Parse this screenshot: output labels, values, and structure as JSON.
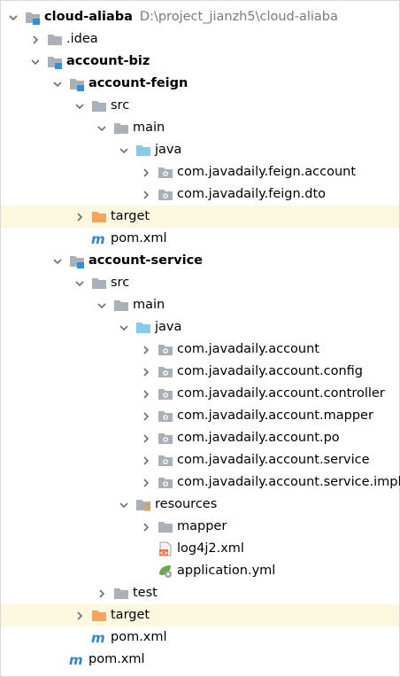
{
  "tree": {
    "nodes": [
      {
        "label": "cloud-aliaba",
        "detail": "D:\\project_jianzh5\\cloud-aliaba",
        "depth": 0,
        "icon": "module-folder-icon",
        "toggle": "expanded",
        "bold": true
      },
      {
        "label": ".idea",
        "depth": 1,
        "icon": "folder-icon",
        "toggle": "collapsed"
      },
      {
        "label": "account-biz",
        "depth": 1,
        "icon": "module-folder-icon",
        "toggle": "expanded",
        "bold": true
      },
      {
        "label": "account-feign",
        "depth": 2,
        "icon": "module-folder-icon",
        "toggle": "expanded",
        "bold": true
      },
      {
        "label": "src",
        "depth": 3,
        "icon": "folder-icon",
        "toggle": "expanded"
      },
      {
        "label": "main",
        "depth": 4,
        "icon": "folder-icon",
        "toggle": "expanded"
      },
      {
        "label": "java",
        "depth": 5,
        "icon": "source-root-folder-icon",
        "toggle": "expanded"
      },
      {
        "label": "com.javadaily.feign.account",
        "depth": 6,
        "icon": "package-icon",
        "toggle": "collapsed"
      },
      {
        "label": "com.javadaily.feign.dto",
        "depth": 6,
        "icon": "package-icon",
        "toggle": "collapsed"
      },
      {
        "label": "target",
        "depth": 3,
        "icon": "excluded-folder-icon",
        "toggle": "collapsed",
        "excluded": true
      },
      {
        "label": "pom.xml",
        "depth": 3,
        "icon": "maven-icon",
        "toggle": "none"
      },
      {
        "label": "account-service",
        "depth": 2,
        "icon": "module-folder-icon",
        "toggle": "expanded",
        "bold": true
      },
      {
        "label": "src",
        "depth": 3,
        "icon": "folder-icon",
        "toggle": "expanded"
      },
      {
        "label": "main",
        "depth": 4,
        "icon": "folder-icon",
        "toggle": "expanded"
      },
      {
        "label": "java",
        "depth": 5,
        "icon": "source-root-folder-icon",
        "toggle": "expanded"
      },
      {
        "label": "com.javadaily.account",
        "depth": 6,
        "icon": "package-icon",
        "toggle": "collapsed"
      },
      {
        "label": "com.javadaily.account.config",
        "depth": 6,
        "icon": "package-icon",
        "toggle": "collapsed"
      },
      {
        "label": "com.javadaily.account.controller",
        "depth": 6,
        "icon": "package-icon",
        "toggle": "collapsed"
      },
      {
        "label": "com.javadaily.account.mapper",
        "depth": 6,
        "icon": "package-icon",
        "toggle": "collapsed"
      },
      {
        "label": "com.javadaily.account.po",
        "depth": 6,
        "icon": "package-icon",
        "toggle": "collapsed"
      },
      {
        "label": "com.javadaily.account.service",
        "depth": 6,
        "icon": "package-icon",
        "toggle": "collapsed"
      },
      {
        "label": "com.javadaily.account.service.impl",
        "depth": 6,
        "icon": "package-icon",
        "toggle": "collapsed"
      },
      {
        "label": "resources",
        "depth": 5,
        "icon": "resources-folder-icon",
        "toggle": "expanded"
      },
      {
        "label": "mapper",
        "depth": 6,
        "icon": "folder-icon",
        "toggle": "collapsed"
      },
      {
        "label": "log4j2.xml",
        "depth": 6,
        "icon": "xml-file-icon",
        "toggle": "none"
      },
      {
        "label": "application.yml",
        "depth": 6,
        "icon": "yml-file-icon",
        "toggle": "none"
      },
      {
        "label": "test",
        "depth": 4,
        "icon": "folder-icon",
        "toggle": "collapsed"
      },
      {
        "label": "target",
        "depth": 3,
        "icon": "excluded-folder-icon",
        "toggle": "collapsed",
        "excluded": true
      },
      {
        "label": "pom.xml",
        "depth": 3,
        "icon": "maven-icon",
        "toggle": "none"
      },
      {
        "label": "pom.xml",
        "depth": 2,
        "icon": "maven-icon",
        "toggle": "none"
      }
    ]
  },
  "colors": {
    "folder": "#a9b0b7",
    "source_root": "#87cbe8",
    "excluded": "#f4a460",
    "excluded_row_bg": "#fcf8e0",
    "module_marker": "#2f8fd8",
    "maven": "#2d84cf",
    "xml_badge": "#e7783b",
    "yml_leaf": "#6aa84f",
    "chevron": "#6e6e6e",
    "path_text": "#7a7a7a"
  }
}
